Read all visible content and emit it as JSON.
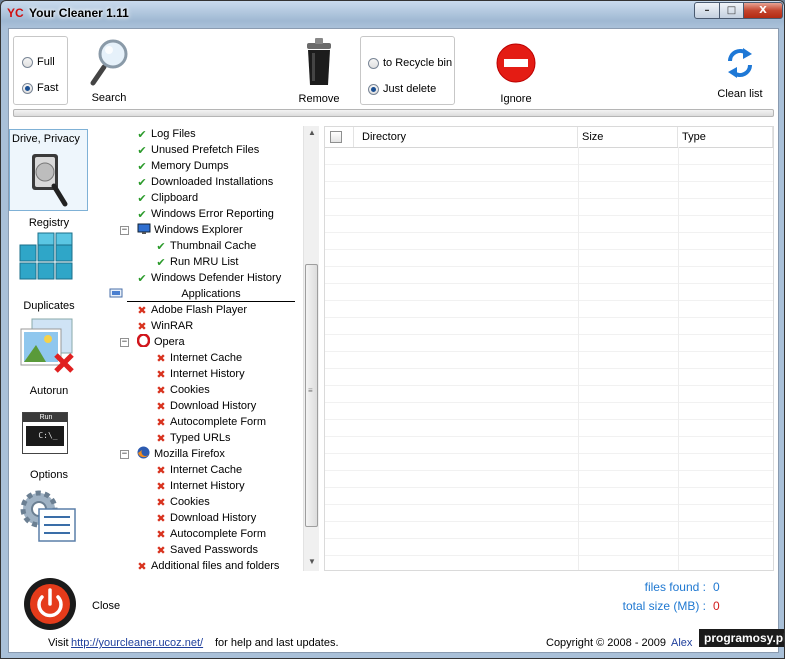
{
  "window": {
    "logo": "YC",
    "title": "Your Cleaner 1.11",
    "min": "–",
    "max": "□",
    "close": "X"
  },
  "mode": {
    "full": "Full",
    "fast": "Fast",
    "selected": "fast"
  },
  "toolbar": {
    "search": "Search",
    "remove": "Remove",
    "ignore": "Ignore",
    "clean_list": "Clean list"
  },
  "delete_mode": {
    "recycle": "to Recycle bin",
    "just_delete": "Just delete",
    "selected": "just_delete"
  },
  "nav": {
    "drive": "Drive, Privacy",
    "registry": "Registry",
    "duplicates": "Duplicates",
    "autorun": "Autorun",
    "autorun_icon_text": "Run",
    "autorun_prompt": "C:\\_",
    "options": "Options",
    "close": "Close"
  },
  "tree": [
    {
      "label": "Log Files",
      "state": "checked",
      "level": 1
    },
    {
      "label": "Unused Prefetch Files",
      "state": "checked",
      "level": 1
    },
    {
      "label": "Memory Dumps",
      "state": "checked",
      "level": 1
    },
    {
      "label": "Downloaded Installations",
      "state": "checked",
      "level": 1
    },
    {
      "label": "Clipboard",
      "state": "checked",
      "level": 1
    },
    {
      "label": "Windows Error Reporting",
      "state": "checked",
      "level": 1
    },
    {
      "label": "Windows Explorer",
      "state": "group",
      "level": 1,
      "icon": "explorer-icon"
    },
    {
      "label": "Thumbnail Cache",
      "state": "checked",
      "level": 2
    },
    {
      "label": "Run MRU List",
      "state": "checked",
      "level": 2
    },
    {
      "label": "Windows Defender History",
      "state": "checked",
      "level": 1
    },
    {
      "label": "Applications",
      "state": "section",
      "level": 0
    },
    {
      "label": "Adobe Flash Player",
      "state": "unchecked",
      "level": 1
    },
    {
      "label": "WinRAR",
      "state": "unchecked",
      "level": 1
    },
    {
      "label": "Opera",
      "state": "group",
      "level": 1,
      "icon": "opera-icon"
    },
    {
      "label": "Internet Cache",
      "state": "unchecked",
      "level": 2
    },
    {
      "label": "Internet History",
      "state": "unchecked",
      "level": 2
    },
    {
      "label": "Cookies",
      "state": "unchecked",
      "level": 2
    },
    {
      "label": "Download History",
      "state": "unchecked",
      "level": 2
    },
    {
      "label": "Autocomplete Form",
      "state": "unchecked",
      "level": 2
    },
    {
      "label": "Typed URLs",
      "state": "unchecked",
      "level": 2
    },
    {
      "label": "Mozilla Firefox",
      "state": "group",
      "level": 1,
      "icon": "firefox-icon"
    },
    {
      "label": "Internet Cache",
      "state": "unchecked",
      "level": 2
    },
    {
      "label": "Internet History",
      "state": "unchecked",
      "level": 2
    },
    {
      "label": "Cookies",
      "state": "unchecked",
      "level": 2
    },
    {
      "label": "Download History",
      "state": "unchecked",
      "level": 2
    },
    {
      "label": "Autocomplete Form",
      "state": "unchecked",
      "level": 2
    },
    {
      "label": "Saved Passwords",
      "state": "unchecked",
      "level": 2
    },
    {
      "label": "Additional files and folders",
      "state": "unchecked",
      "level": 1
    }
  ],
  "table": {
    "columns": [
      "Directory",
      "Size",
      "Type"
    ]
  },
  "stats": {
    "files_found_label": "files found :",
    "files_found": "0",
    "total_size_label": "total size (MB) :",
    "total_size": "0"
  },
  "footer": {
    "visit": "Visit",
    "link": "http://yourcleaner.ucoz.net/",
    "help": "for help and last updates.",
    "copyright": "Copyright © 2008 - 2009",
    "author": "Alex",
    "watermark": "programosy.pl"
  }
}
